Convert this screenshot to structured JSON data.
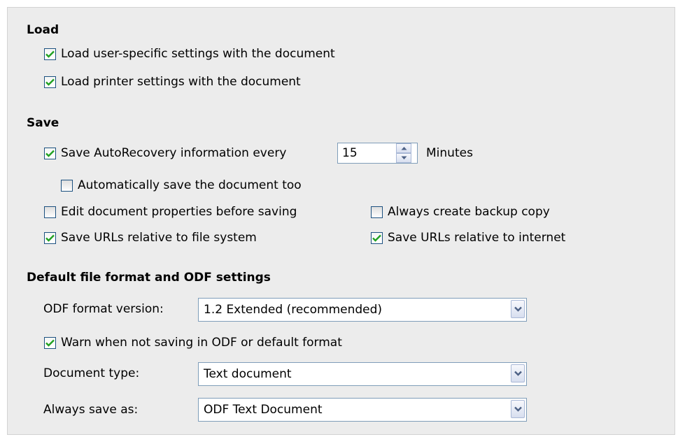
{
  "load": {
    "heading": "Load",
    "user_settings": {
      "label": "Load user-specific settings with the document",
      "checked": true
    },
    "printer_settings": {
      "label": "Load printer settings with the document",
      "checked": true
    }
  },
  "save": {
    "heading": "Save",
    "autorecovery": {
      "label": "Save AutoRecovery information every",
      "checked": true,
      "value": "15",
      "unit": "Minutes"
    },
    "auto_save_doc": {
      "label": "Automatically save the document too",
      "checked": false
    },
    "edit_props": {
      "label": "Edit document properties before saving",
      "checked": false
    },
    "backup_copy": {
      "label": "Always create backup copy",
      "checked": false
    },
    "urls_file_system": {
      "label": "Save URLs relative to file system",
      "checked": true
    },
    "urls_internet": {
      "label": "Save URLs relative to internet",
      "checked": true
    }
  },
  "format": {
    "heading": "Default file format and ODF settings",
    "odf_version_label": "ODF format version:",
    "odf_version_value": "1.2 Extended (recommended)",
    "warn": {
      "label": "Warn when not saving in ODF or default format",
      "checked": true
    },
    "doc_type_label": "Document type:",
    "doc_type_value": "Text document",
    "save_as_label": "Always save as:",
    "save_as_value": "ODF Text Document"
  },
  "icons": {
    "checkbox": "checkmark-icon",
    "dropdown": "chevron-down-icon",
    "spinner": "spin-arrows-icon"
  }
}
